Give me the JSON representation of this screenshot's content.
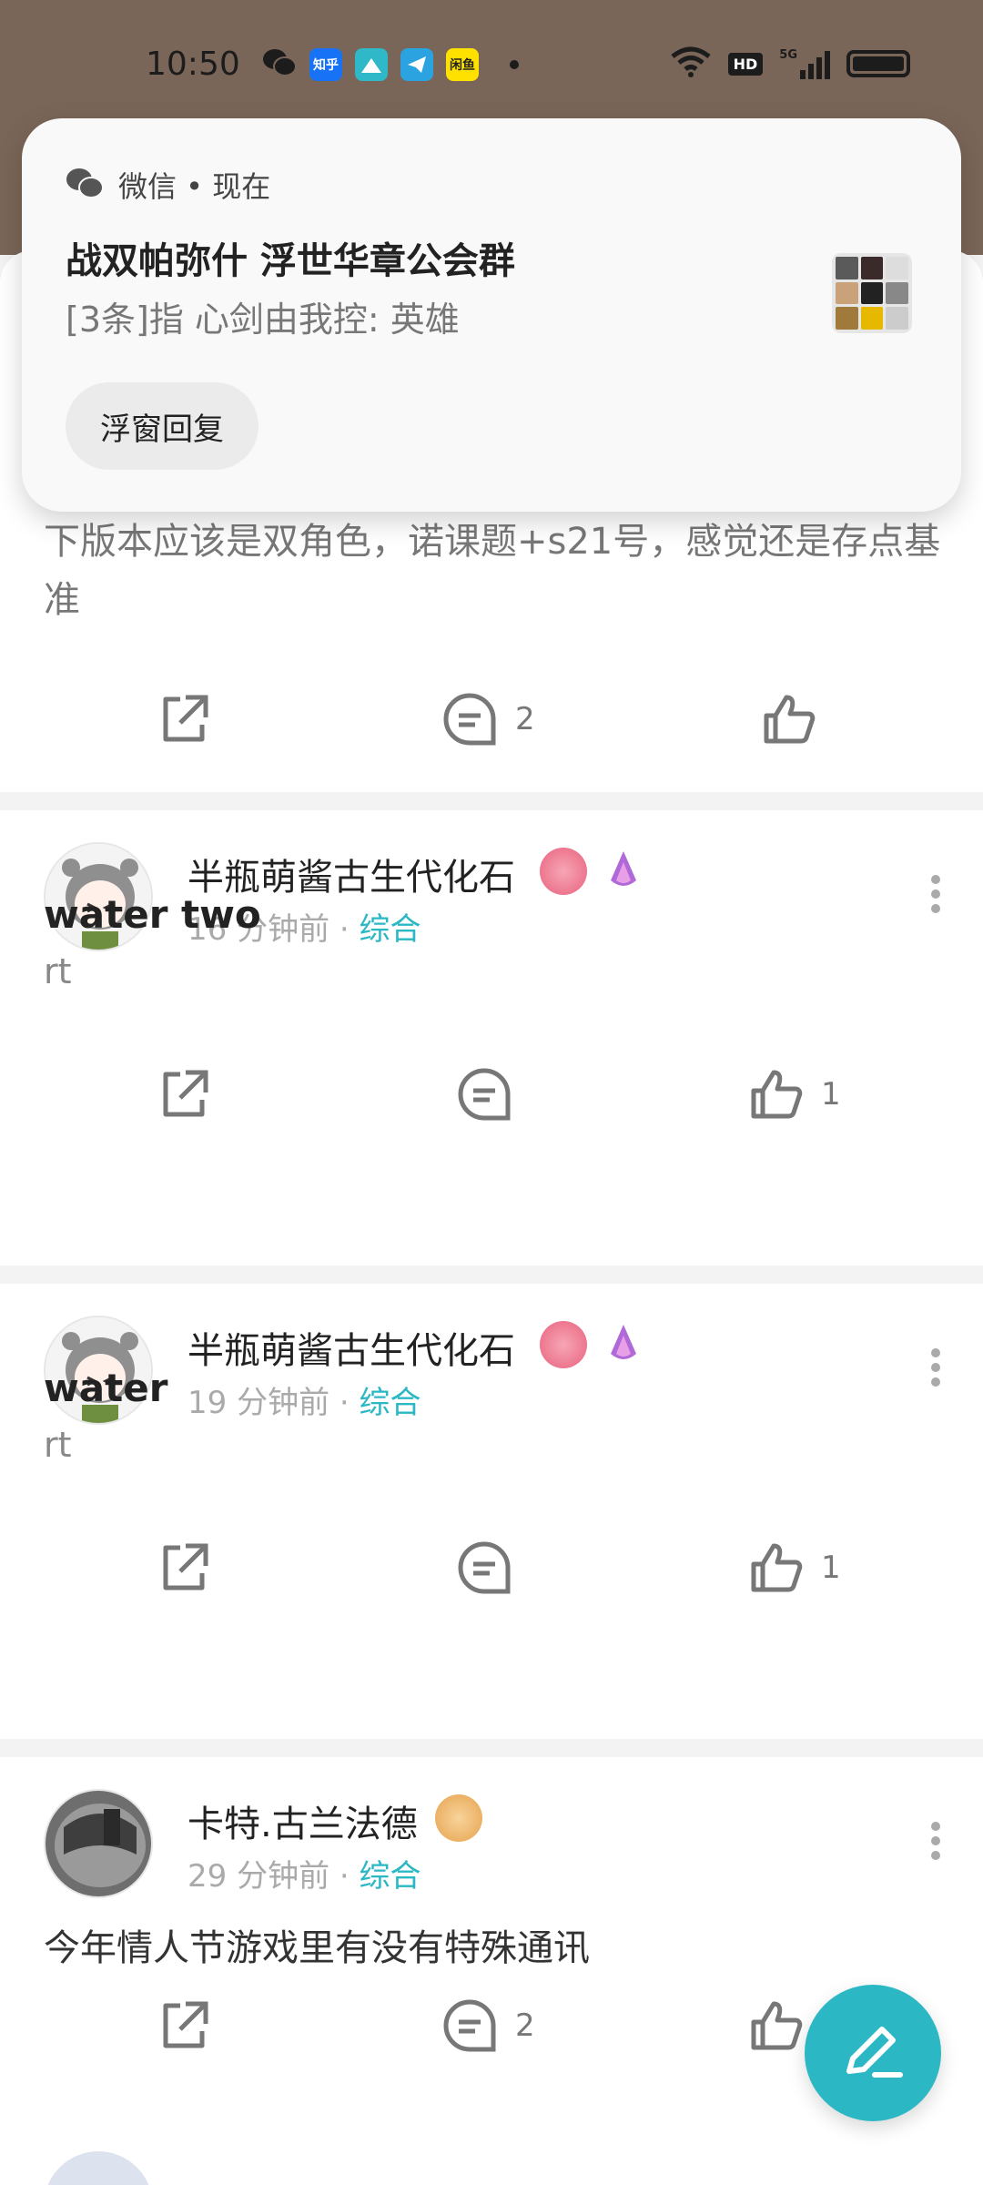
{
  "status_bar": {
    "time": "10:50",
    "hd_label": "HD",
    "network_label": "5G",
    "app_icons": [
      {
        "name": "wechat-icon",
        "label": ""
      },
      {
        "name": "zhihu-icon",
        "label": "知乎",
        "color": "#1772f6"
      },
      {
        "name": "app-icon",
        "label": "",
        "color": "#2fb8c8"
      },
      {
        "name": "telegram-icon",
        "label": "",
        "color": "#2aa3e0"
      },
      {
        "name": "xianyu-icon",
        "label": "闲鱼",
        "color": "#ffe100"
      }
    ]
  },
  "notification": {
    "app_name": "微信 • 现在",
    "title": "战双帕弥什 浮世华章公会群",
    "text": "[3条]指 心剑由我控: 英雄",
    "reply_button": "浮窗回复"
  },
  "partial_post": {
    "text": "下版本应该是双角色，诺课题+s21号，感觉还是存点基准",
    "comment_count": "2",
    "like_count": ""
  },
  "posts": [
    {
      "author": "半瓶萌酱古生代化石",
      "time": "16 分钟前",
      "category": "综合",
      "title": "water two",
      "body": "rt",
      "comment_count": "",
      "like_count": "1"
    },
    {
      "author": "半瓶萌酱古生代化石",
      "time": "19 分钟前",
      "category": "综合",
      "title": "water",
      "body": "rt",
      "comment_count": "",
      "like_count": "1"
    },
    {
      "author": "卡特.古兰法德",
      "time": "29 分钟前",
      "category": "综合",
      "title": "",
      "body": "今年情人节游戏里有没有特殊通讯",
      "comment_count": "2",
      "like_count": ""
    }
  ],
  "meta_separator": " · ",
  "colors": {
    "accent": "#2bb7c4",
    "wallpaper": "#7a6658"
  }
}
